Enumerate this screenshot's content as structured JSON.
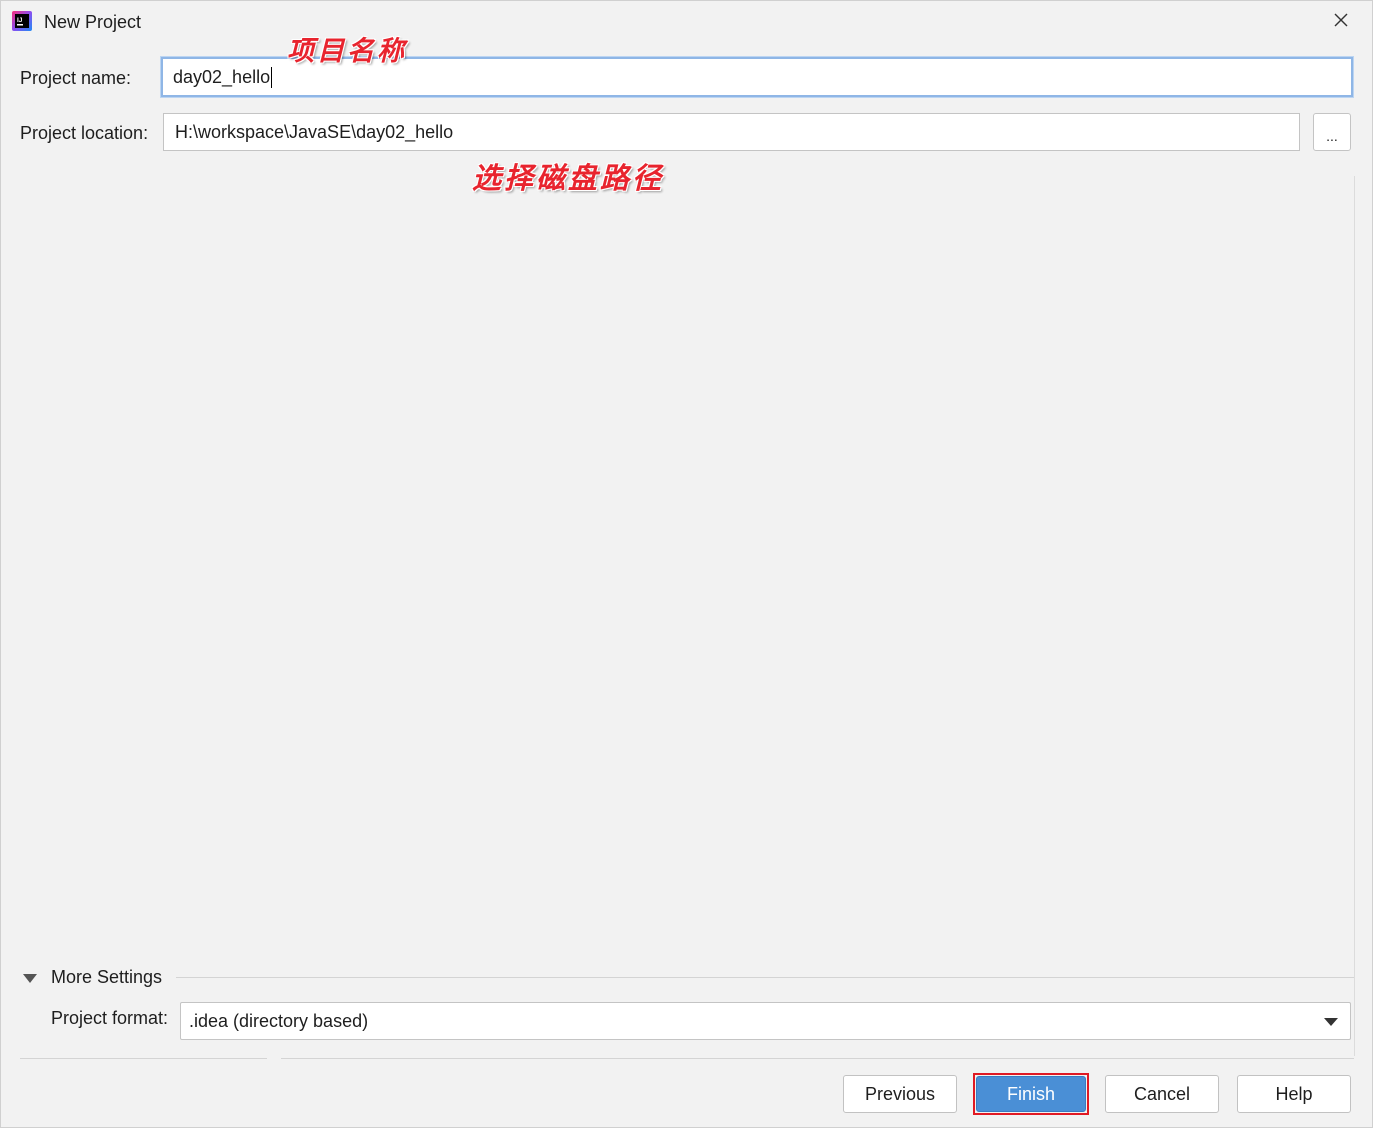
{
  "window": {
    "title": "New Project",
    "app_icon": "intellij-idea-icon",
    "close_icon": "close-icon"
  },
  "form": {
    "project_name_label": "Project name:",
    "project_name_value": "day02_hello",
    "project_location_label": "Project location:",
    "project_location_value": "H:\\workspace\\JavaSE\\day02_hello",
    "browse_label": "..."
  },
  "annotations": {
    "name_note": "项目名称",
    "location_note": "选择磁盘路径"
  },
  "more_settings": {
    "label": "More Settings",
    "project_format_label": "Project format:",
    "project_format_value": ".idea (directory based)"
  },
  "buttons": {
    "previous": "Previous",
    "finish": "Finish",
    "cancel": "Cancel",
    "help": "Help"
  },
  "colors": {
    "annotation_red": "#e8242e",
    "primary_blue": "#4a8fd6",
    "focus_border": "#8fb6e6",
    "background": "#f2f2f2"
  }
}
